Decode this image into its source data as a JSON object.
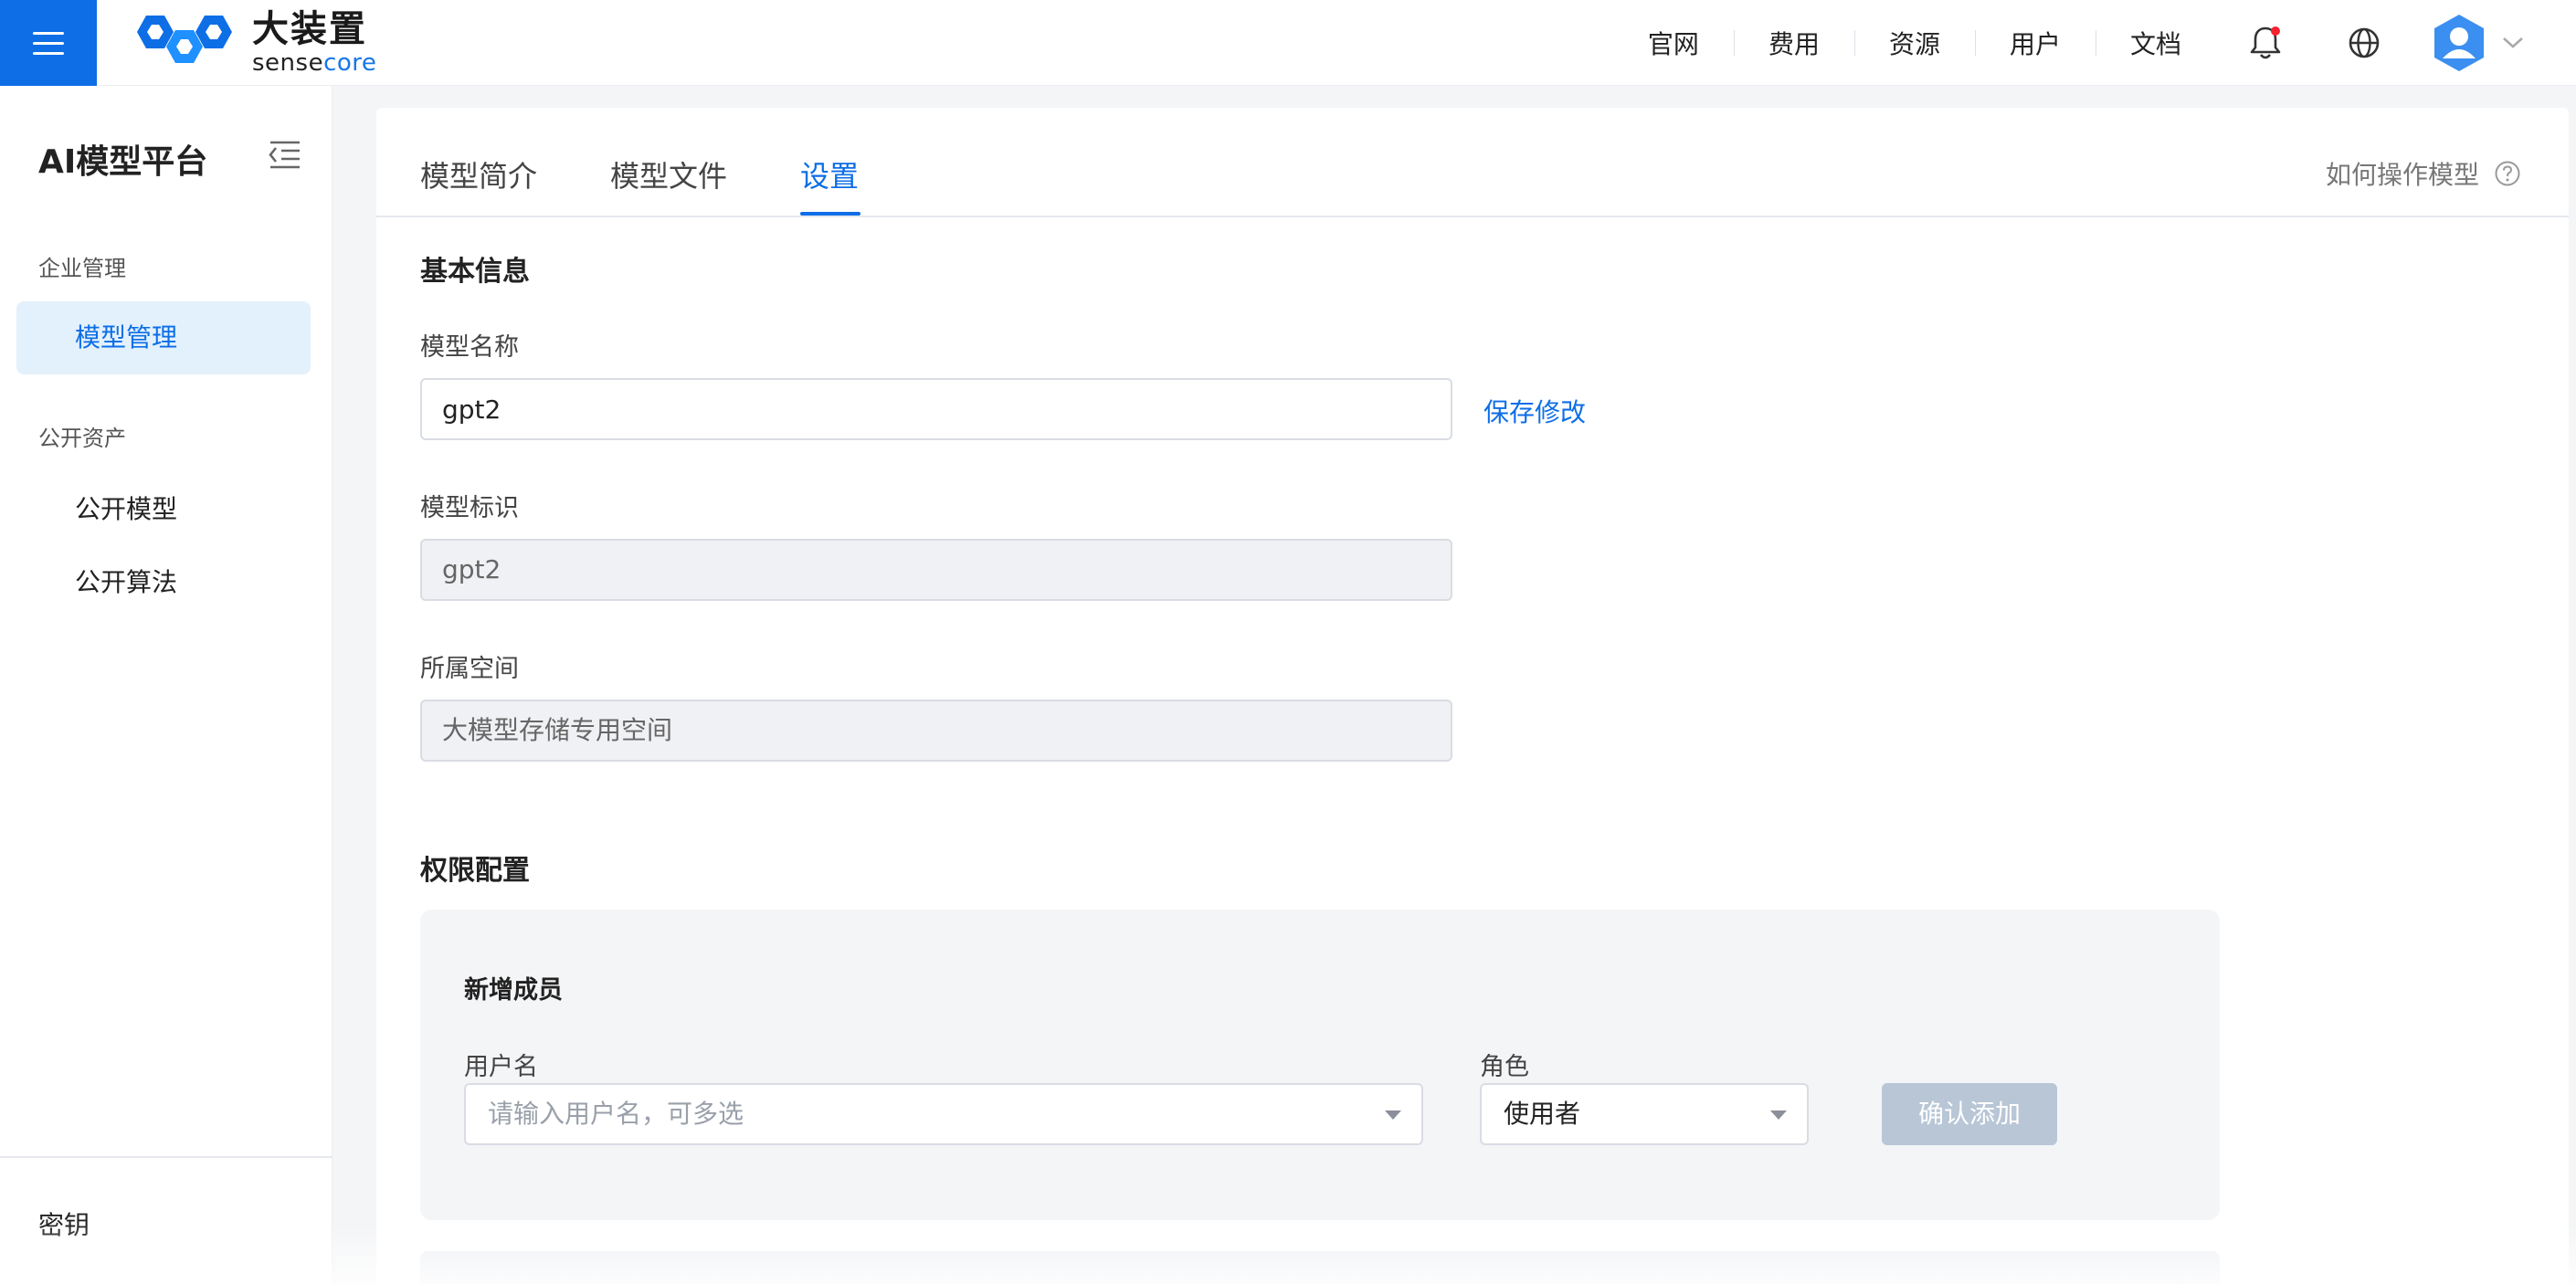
{
  "brand": {
    "cn_name": "大装置",
    "en_name_part1": "sense",
    "en_name_part2": "core",
    "accent_color": "#0d6ee6"
  },
  "topnav": {
    "items": [
      "官网",
      "费用",
      "资源",
      "用户",
      "文档"
    ],
    "icons": [
      "bell-icon",
      "globe-icon",
      "user-avatar-icon",
      "chevron-down-icon"
    ],
    "has_notification_badge": true
  },
  "sidebar": {
    "title": "AI模型平台",
    "groups": [
      {
        "label": "企业管理",
        "items": [
          {
            "label": "模型管理",
            "active": true
          }
        ]
      },
      {
        "label": "公开资产",
        "items": [
          {
            "label": "公开模型",
            "active": false
          },
          {
            "label": "公开算法",
            "active": false
          }
        ]
      }
    ],
    "bottom_item": "密钥"
  },
  "tabs": {
    "items": [
      "模型简介",
      "模型文件",
      "设置"
    ],
    "active": "设置",
    "help_label": "如何操作模型"
  },
  "basic_info": {
    "title": "基本信息",
    "name_label": "模型名称",
    "name_value": "gpt2",
    "save_label": "保存修改",
    "id_label": "模型标识",
    "id_value": "gpt2",
    "space_label": "所属空间",
    "space_value": "大模型存储专用空间"
  },
  "permissions": {
    "title": "权限配置",
    "add_title": "新增成员",
    "username_label": "用户名",
    "username_placeholder": "请输入用户名，可多选",
    "role_label": "角色",
    "role_value": "使用者",
    "confirm_label": "确认添加"
  }
}
